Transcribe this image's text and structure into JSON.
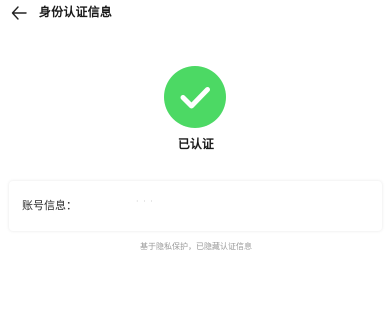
{
  "header": {
    "back_icon": "arrow-left-icon",
    "title": "身份认证信息"
  },
  "status": {
    "icon": "check-circle-icon",
    "icon_color": "#4cd964",
    "label": "已认证"
  },
  "account": {
    "label": "账号信息：",
    "value": "· · ·"
  },
  "footnote": "基于隐私保护，已隐藏认证信息"
}
